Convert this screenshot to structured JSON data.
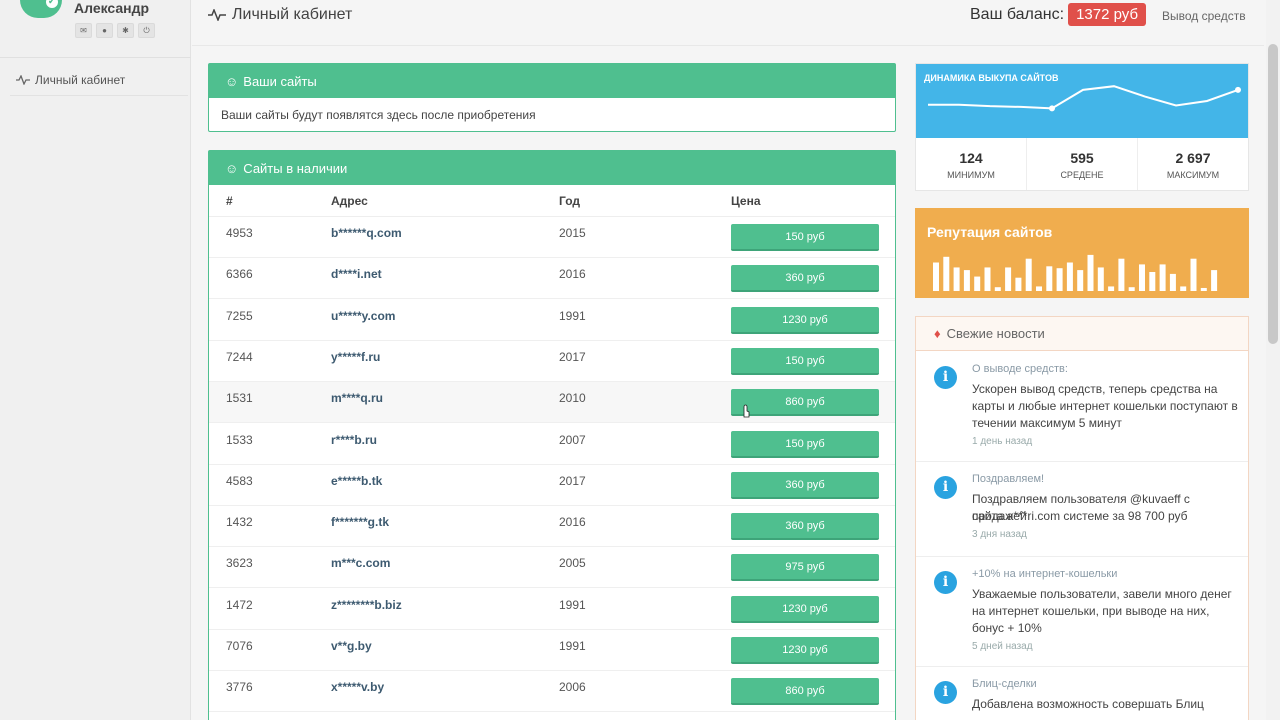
{
  "user": {
    "name": "Александр"
  },
  "sidebar": {
    "items": [
      {
        "label": "Личный кабинет"
      }
    ]
  },
  "header": {
    "title": "Личный кабинет",
    "balance_label": "Ваш баланс:",
    "balance_value": "1372 руб",
    "withdraw_label": "Вывод средств"
  },
  "my_sites": {
    "title": "Ваши сайты",
    "empty_text": "Ваши сайты будут появлятся здесь после приобретения"
  },
  "available": {
    "title": "Сайты в наличии",
    "columns": [
      "#",
      "Адрес",
      "Год",
      "Цена"
    ],
    "rows": [
      {
        "id": "4953",
        "address": "b******q.com",
        "year": "2015",
        "price": "150 руб"
      },
      {
        "id": "6366",
        "address": "d****i.net",
        "year": "2016",
        "price": "360 руб"
      },
      {
        "id": "7255",
        "address": "u*****y.com",
        "year": "1991",
        "price": "1230 руб"
      },
      {
        "id": "7244",
        "address": "y*****f.ru",
        "year": "2017",
        "price": "150 руб"
      },
      {
        "id": "1531",
        "address": "m****q.ru",
        "year": "2010",
        "price": "860 руб"
      },
      {
        "id": "1533",
        "address": "r****b.ru",
        "year": "2007",
        "price": "150 руб"
      },
      {
        "id": "4583",
        "address": "e*****b.tk",
        "year": "2017",
        "price": "360 руб"
      },
      {
        "id": "1432",
        "address": "f*******g.tk",
        "year": "2016",
        "price": "360 руб"
      },
      {
        "id": "3623",
        "address": "m***c.com",
        "year": "2005",
        "price": "975 руб"
      },
      {
        "id": "1472",
        "address": "z********b.biz",
        "year": "1991",
        "price": "1230 руб"
      },
      {
        "id": "7076",
        "address": "v**g.by",
        "year": "1991",
        "price": "1230 руб"
      },
      {
        "id": "3776",
        "address": "x*****v.by",
        "year": "2006",
        "price": "860 руб"
      }
    ]
  },
  "dynamics": {
    "title": "ДИНАМИКА ВЫКУПА САЙТОВ",
    "line_values": [
      0.55,
      0.55,
      0.57,
      0.58,
      0.6,
      0.35,
      0.3,
      0.44,
      0.56,
      0.5,
      0.35
    ],
    "stats": [
      {
        "value": "124",
        "label": "МИНИМУМ"
      },
      {
        "value": "595",
        "label": "СРЕДЕНЕ"
      },
      {
        "value": "2 697",
        "label": "МАКСИМУМ"
      }
    ],
    "colors": {
      "bg": "#43b5e8"
    }
  },
  "reputation": {
    "title": "Репутация сайтов",
    "bar_values": [
      0.75,
      0.9,
      0.62,
      0.55,
      0.38,
      0.62,
      0.1,
      0.62,
      0.35,
      0.85,
      0.12,
      0.65,
      0.6,
      0.75,
      0.55,
      0.95,
      0.62,
      0.12,
      0.85,
      0.1,
      0.7,
      0.5,
      0.7,
      0.45,
      0.12,
      0.85,
      0.08,
      0.55
    ],
    "colors": {
      "bg": "#f0ad4e"
    }
  },
  "news": {
    "title": "Свежие новости",
    "items": [
      {
        "title": "О выводе средств:",
        "lines": [
          "Ускорен вывод средств, теперь средства на",
          "карты и любые интернет кошельки поступают в",
          "течении максимум 5 минут"
        ],
        "time": "1 день назад"
      },
      {
        "title": "Поздравляем!",
        "lines": [
          "Поздравляем пользователя @kuvaeff с продажей",
          "сайта a***ri.com системе за 98 700 руб"
        ],
        "time": "3 дня назад"
      },
      {
        "title": "+10% на интернет-кошельки",
        "lines": [
          "Уважаемые пользователи, завели много денег",
          "на интернет кошельки, при выводе на них,",
          "бонус + 10%"
        ],
        "time": "5 дней назад"
      },
      {
        "title": "Блиц-сделки",
        "lines": [
          "Добавлена возможность совершать Блиц"
        ],
        "time": ""
      }
    ]
  },
  "colors": {
    "accent": "#4fbf8f",
    "badge": "#e0504a",
    "info": "#2aa3e0"
  }
}
